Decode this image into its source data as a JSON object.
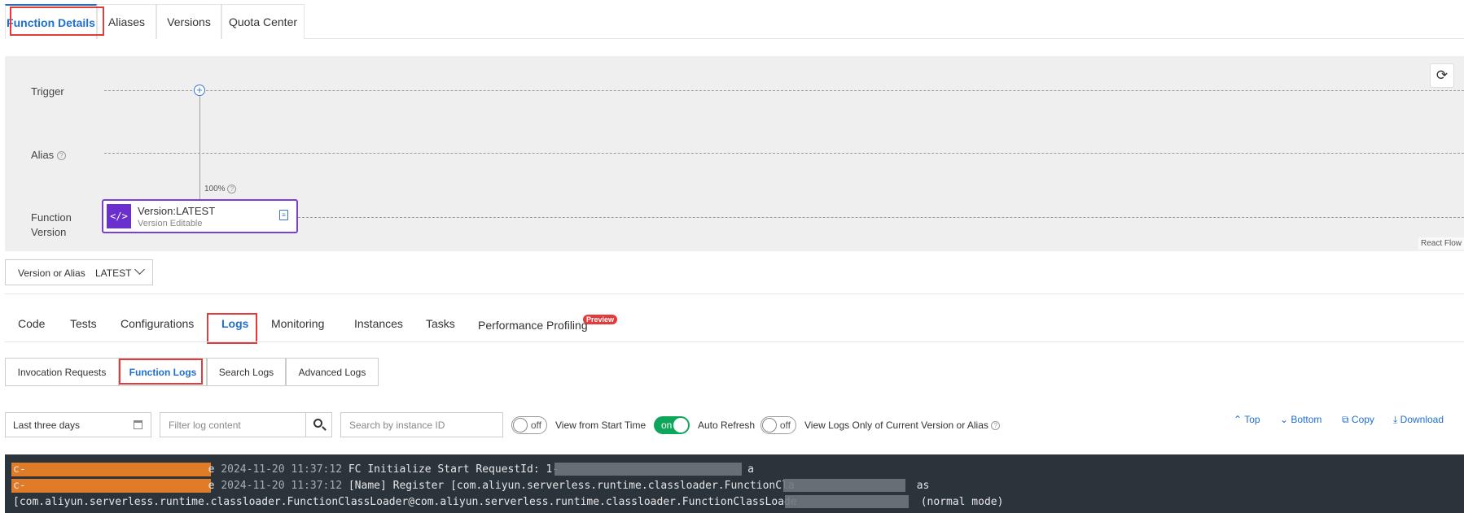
{
  "top_tabs": [
    {
      "label": "Function Details",
      "active": true
    },
    {
      "label": "Aliases",
      "active": false
    },
    {
      "label": "Versions",
      "active": false
    },
    {
      "label": "Quota Center",
      "active": false
    }
  ],
  "flow": {
    "rows": [
      "Trigger",
      "Alias",
      "Function\nVersion"
    ],
    "help_icon": "question-circle-icon",
    "percentage": "100%",
    "node": {
      "title": "Version:LATEST",
      "subtitle": "Version Editable",
      "icon": "code-icon",
      "action_icon": "document-icon"
    },
    "refresh_icon": "refresh-icon",
    "attribution": "React Flow"
  },
  "version_select": {
    "label": "Version or Alias",
    "value": "LATEST"
  },
  "sub_tabs": [
    {
      "label": "Code",
      "active": false
    },
    {
      "label": "Tests",
      "active": false
    },
    {
      "label": "Configurations",
      "active": false
    },
    {
      "label": "Logs",
      "active": true
    },
    {
      "label": "Monitoring",
      "active": false
    },
    {
      "label": "Instances",
      "active": false
    },
    {
      "label": "Tasks",
      "active": false
    },
    {
      "label": "Performance Profiling",
      "active": false,
      "badge": "Preview"
    }
  ],
  "log_tabs": [
    {
      "label": "Invocation Requests",
      "active": false
    },
    {
      "label": "Function Logs",
      "active": true
    },
    {
      "label": "Search Logs",
      "active": false
    },
    {
      "label": "Advanced Logs",
      "active": false
    }
  ],
  "filters": {
    "time_range": "Last three days",
    "filter_placeholder": "Filter log content",
    "instance_placeholder": "Search by instance ID"
  },
  "toggles": [
    {
      "state": "off",
      "label": "View from Start Time"
    },
    {
      "state": "on",
      "label": "Auto Refresh"
    },
    {
      "state": "off",
      "label": "View Logs Only of Current Version or Alias"
    }
  ],
  "actions": [
    {
      "label": "Top",
      "icon": "chevron-up-icon"
    },
    {
      "label": "Bottom",
      "icon": "chevron-down-icon"
    },
    {
      "label": "Copy",
      "icon": "copy-icon"
    },
    {
      "label": "Download",
      "icon": "download-icon"
    }
  ],
  "log_lines": [
    {
      "prefix": "c-",
      "suffix": "e",
      "timestamp": "2024-11-20 11:37:12",
      "message": "FC Initialize Start RequestId: 1-",
      "tail": "a"
    },
    {
      "prefix": "c-",
      "suffix": "e",
      "timestamp": "2024-11-20 11:37:12",
      "message": "[Name] Register [com.aliyun.serverless.runtime.classloader.FunctionCla",
      "tail": "as"
    },
    {
      "text": "[com.aliyun.serverless.runtime.classloader.FunctionClassLoader@com.aliyun.serverless.runtime.classloader.FunctionClassLoade",
      "tail": "(normal mode)"
    }
  ]
}
